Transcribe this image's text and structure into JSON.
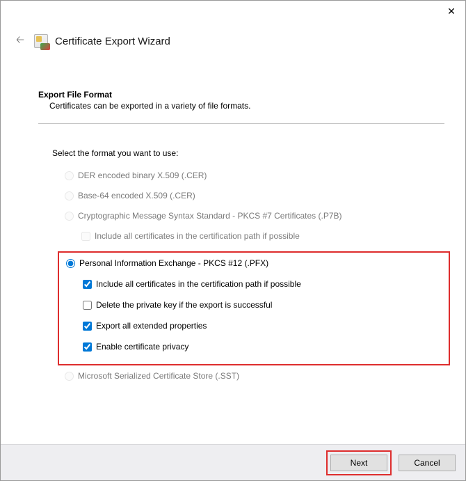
{
  "window": {
    "title": "Certificate Export Wizard"
  },
  "page": {
    "heading": "Export File Format",
    "subheading": "Certificates can be exported in a variety of file formats.",
    "instruction": "Select the format you want to use:"
  },
  "options": {
    "der": {
      "label": "DER encoded binary X.509 (.CER)"
    },
    "base64": {
      "label": "Base-64 encoded X.509 (.CER)"
    },
    "p7b": {
      "label": "Cryptographic Message Syntax Standard - PKCS #7 Certificates (.P7B)",
      "sub_include": "Include all certificates in the certification path if possible"
    },
    "pfx": {
      "label": "Personal Information Exchange - PKCS #12 (.PFX)",
      "sub_include": "Include all certificates in the certification path if possible",
      "sub_delete": "Delete the private key if the export is successful",
      "sub_ext": "Export all extended properties",
      "sub_privacy": "Enable certificate privacy"
    },
    "sst": {
      "label": "Microsoft Serialized Certificate Store (.SST)"
    }
  },
  "buttons": {
    "next": "Next",
    "cancel": "Cancel"
  }
}
